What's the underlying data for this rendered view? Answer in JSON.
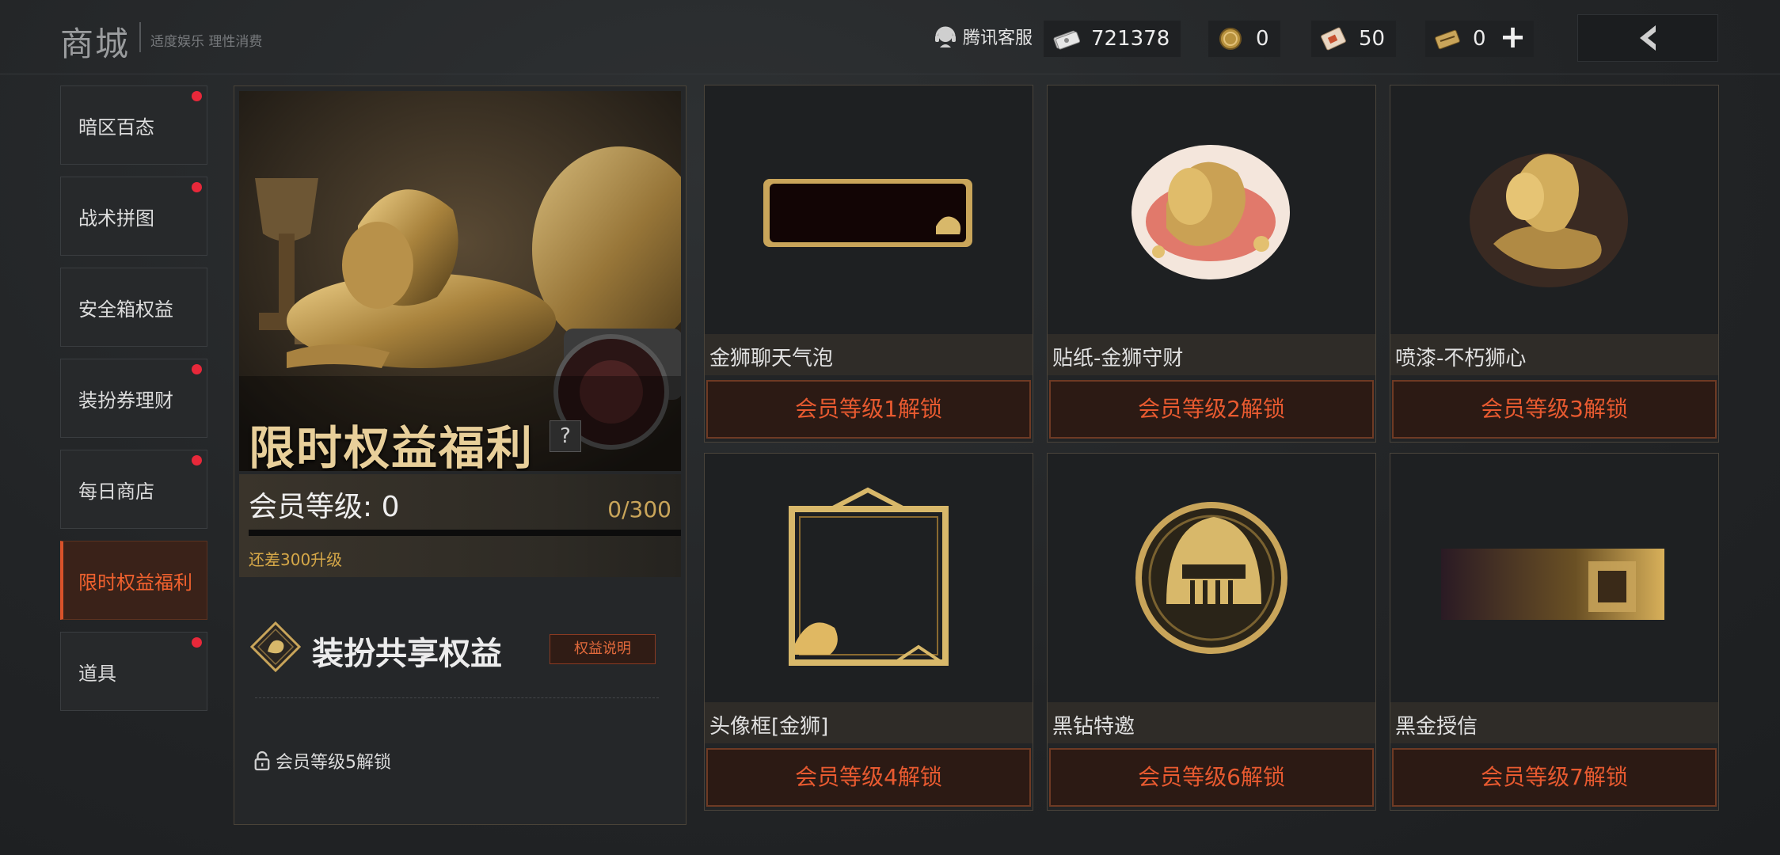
{
  "header": {
    "title": "商城",
    "slogan": "适度娱乐 理性消费",
    "support_label": "腾讯客服",
    "currencies": [
      {
        "icon": "banknote-icon",
        "value": "721378"
      },
      {
        "icon": "gold-coin-icon",
        "value": "0"
      },
      {
        "icon": "voucher-card-icon",
        "value": "50"
      },
      {
        "icon": "gold-ticket-icon",
        "value": "0"
      }
    ],
    "plus_label": "+",
    "back_icon": "chevron-left-icon"
  },
  "sidebar": {
    "items": [
      {
        "label": "暗区百态",
        "has_dot": true,
        "active": false
      },
      {
        "label": "战术拼图",
        "has_dot": true,
        "active": false
      },
      {
        "label": "安全箱权益",
        "has_dot": false,
        "active": false
      },
      {
        "label": "装扮券理财",
        "has_dot": true,
        "active": false
      },
      {
        "label": "每日商店",
        "has_dot": true,
        "active": false
      },
      {
        "label": "限时权益福利",
        "has_dot": false,
        "active": true
      },
      {
        "label": "道具",
        "has_dot": true,
        "active": false
      }
    ]
  },
  "benefit": {
    "hero_title": "限时权益福利",
    "help_label": "?",
    "level_label": "会员等级: 0",
    "progress_text": "0/300",
    "progress_fraction": 0,
    "remain_text": "还差300升级",
    "share_title": "装扮共享权益",
    "benefit_button": "权益说明",
    "unlock_text": "会员等级5解锁"
  },
  "cards": [
    {
      "name": "金狮聊天气泡",
      "unlock": "会员等级1解锁",
      "image": "chat-bubble-frame"
    },
    {
      "name": "贴纸-金狮守财",
      "unlock": "会员等级2解锁",
      "image": "lion-sticker"
    },
    {
      "name": "喷漆-不朽狮心",
      "unlock": "会员等级3解锁",
      "image": "lion-spray"
    },
    {
      "name": "头像框[金狮]",
      "unlock": "会员等级4解锁",
      "image": "avatar-frame"
    },
    {
      "name": "黑钻特邀",
      "unlock": "会员等级6解锁",
      "image": "helmet-badge"
    },
    {
      "name": "黑金授信",
      "unlock": "会员等级7解锁",
      "image": "gold-banner"
    }
  ],
  "colors": {
    "accent_orange": "#e85a30",
    "gold": "#c9a55a",
    "red_dot": "#e8283a"
  }
}
